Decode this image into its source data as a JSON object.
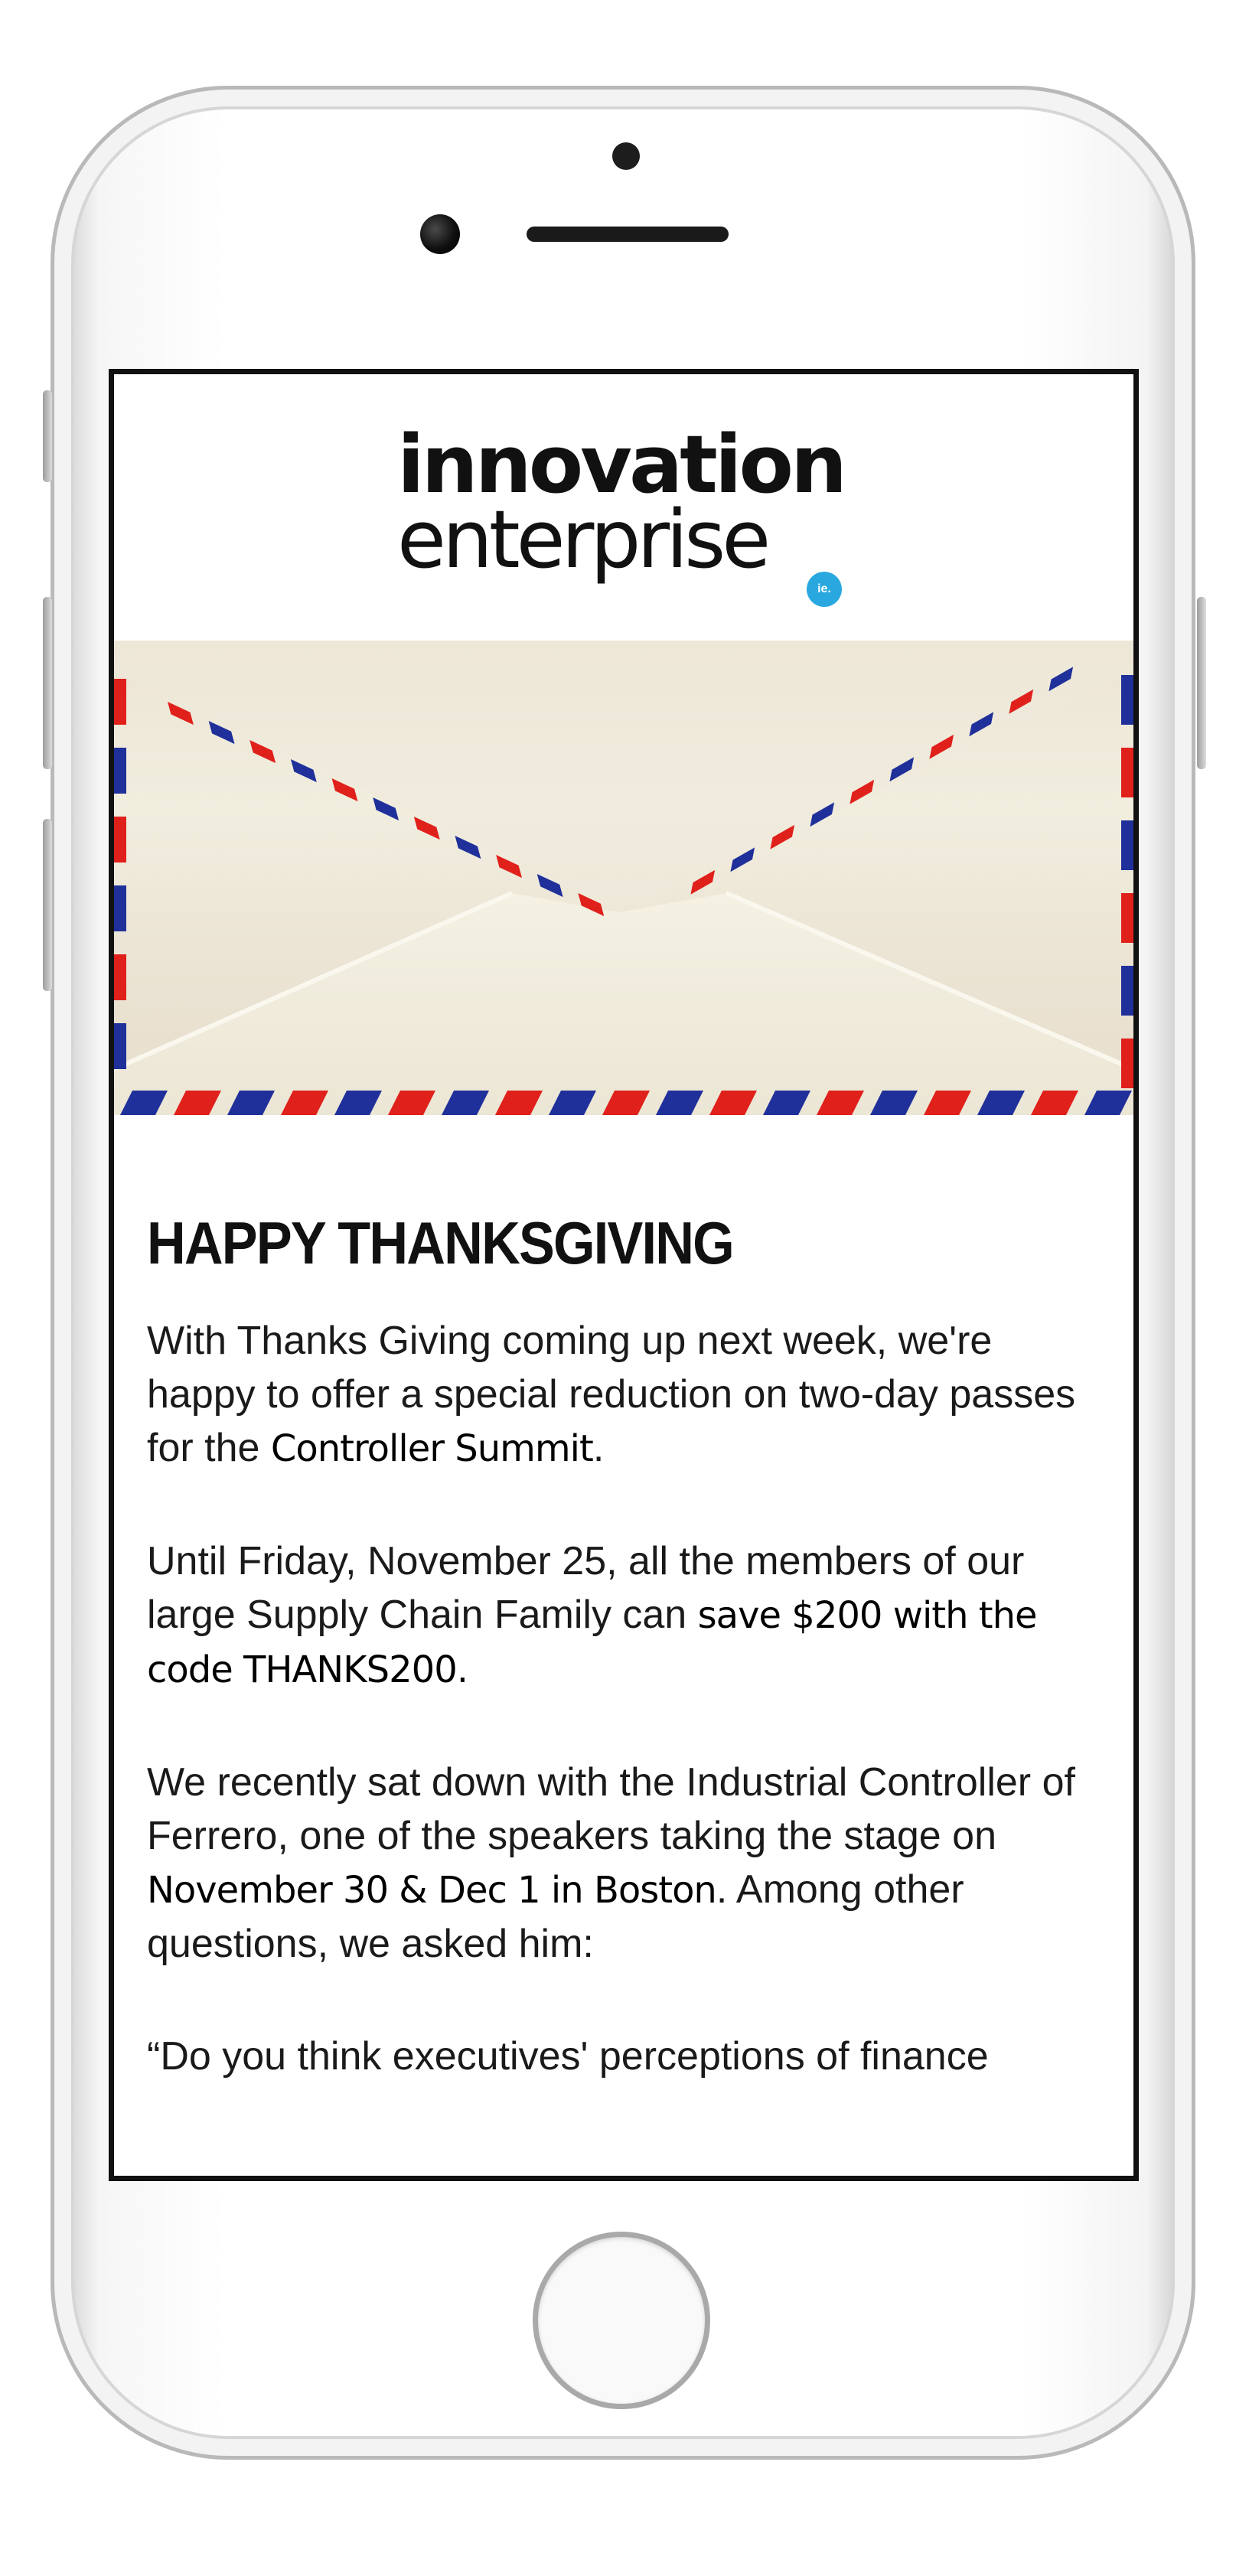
{
  "brand": {
    "logo_line1": "innovation",
    "logo_line2": "enterprise",
    "logo_badge": "ie.",
    "accent_color": "#29a8e0"
  },
  "hero": {
    "image": "airmail-envelope",
    "stripe_red": "#e0201b",
    "stripe_blue": "#20309a"
  },
  "article": {
    "headline": "HAPPY THANKSGIVING",
    "p1": {
      "text": "With Thanks Giving coming up next week, we're happy to offer a special reduction on two-day passes for the ",
      "emphasis": "Controller Summit",
      "end": "."
    },
    "p2": {
      "text": "Until Friday, November 25, all the members of our large Supply Chain Family can ",
      "emphasis": "save $200 with the code THANKS200."
    },
    "p3": {
      "text": "We recently sat down with the Industrial Controller of Ferrero, one of the speakers taking the stage on ",
      "emphasis": "November 30 & Dec 1 in Boston",
      "end": ". Among other questions, we asked him:"
    },
    "p4": {
      "text": "“Do you think executives' perceptions of finance"
    }
  }
}
